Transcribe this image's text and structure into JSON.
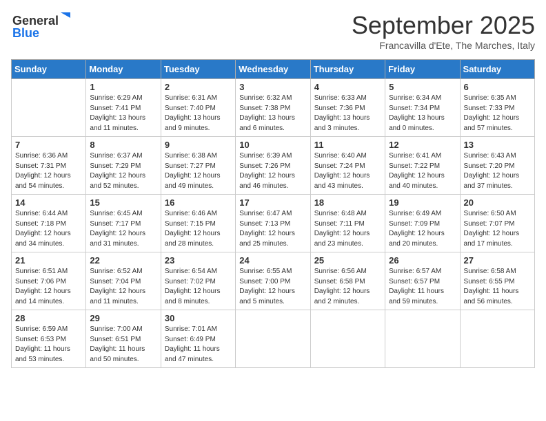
{
  "header": {
    "logo_line1": "General",
    "logo_line2": "Blue",
    "month": "September 2025",
    "location": "Francavilla d'Ete, The Marches, Italy"
  },
  "weekdays": [
    "Sunday",
    "Monday",
    "Tuesday",
    "Wednesday",
    "Thursday",
    "Friday",
    "Saturday"
  ],
  "weeks": [
    [
      {
        "day": "",
        "sunrise": "",
        "sunset": "",
        "daylight": ""
      },
      {
        "day": "1",
        "sunrise": "Sunrise: 6:29 AM",
        "sunset": "Sunset: 7:41 PM",
        "daylight": "Daylight: 13 hours and 11 minutes."
      },
      {
        "day": "2",
        "sunrise": "Sunrise: 6:31 AM",
        "sunset": "Sunset: 7:40 PM",
        "daylight": "Daylight: 13 hours and 9 minutes."
      },
      {
        "day": "3",
        "sunrise": "Sunrise: 6:32 AM",
        "sunset": "Sunset: 7:38 PM",
        "daylight": "Daylight: 13 hours and 6 minutes."
      },
      {
        "day": "4",
        "sunrise": "Sunrise: 6:33 AM",
        "sunset": "Sunset: 7:36 PM",
        "daylight": "Daylight: 13 hours and 3 minutes."
      },
      {
        "day": "5",
        "sunrise": "Sunrise: 6:34 AM",
        "sunset": "Sunset: 7:34 PM",
        "daylight": "Daylight: 13 hours and 0 minutes."
      },
      {
        "day": "6",
        "sunrise": "Sunrise: 6:35 AM",
        "sunset": "Sunset: 7:33 PM",
        "daylight": "Daylight: 12 hours and 57 minutes."
      }
    ],
    [
      {
        "day": "7",
        "sunrise": "Sunrise: 6:36 AM",
        "sunset": "Sunset: 7:31 PM",
        "daylight": "Daylight: 12 hours and 54 minutes."
      },
      {
        "day": "8",
        "sunrise": "Sunrise: 6:37 AM",
        "sunset": "Sunset: 7:29 PM",
        "daylight": "Daylight: 12 hours and 52 minutes."
      },
      {
        "day": "9",
        "sunrise": "Sunrise: 6:38 AM",
        "sunset": "Sunset: 7:27 PM",
        "daylight": "Daylight: 12 hours and 49 minutes."
      },
      {
        "day": "10",
        "sunrise": "Sunrise: 6:39 AM",
        "sunset": "Sunset: 7:26 PM",
        "daylight": "Daylight: 12 hours and 46 minutes."
      },
      {
        "day": "11",
        "sunrise": "Sunrise: 6:40 AM",
        "sunset": "Sunset: 7:24 PM",
        "daylight": "Daylight: 12 hours and 43 minutes."
      },
      {
        "day": "12",
        "sunrise": "Sunrise: 6:41 AM",
        "sunset": "Sunset: 7:22 PM",
        "daylight": "Daylight: 12 hours and 40 minutes."
      },
      {
        "day": "13",
        "sunrise": "Sunrise: 6:43 AM",
        "sunset": "Sunset: 7:20 PM",
        "daylight": "Daylight: 12 hours and 37 minutes."
      }
    ],
    [
      {
        "day": "14",
        "sunrise": "Sunrise: 6:44 AM",
        "sunset": "Sunset: 7:18 PM",
        "daylight": "Daylight: 12 hours and 34 minutes."
      },
      {
        "day": "15",
        "sunrise": "Sunrise: 6:45 AM",
        "sunset": "Sunset: 7:17 PM",
        "daylight": "Daylight: 12 hours and 31 minutes."
      },
      {
        "day": "16",
        "sunrise": "Sunrise: 6:46 AM",
        "sunset": "Sunset: 7:15 PM",
        "daylight": "Daylight: 12 hours and 28 minutes."
      },
      {
        "day": "17",
        "sunrise": "Sunrise: 6:47 AM",
        "sunset": "Sunset: 7:13 PM",
        "daylight": "Daylight: 12 hours and 25 minutes."
      },
      {
        "day": "18",
        "sunrise": "Sunrise: 6:48 AM",
        "sunset": "Sunset: 7:11 PM",
        "daylight": "Daylight: 12 hours and 23 minutes."
      },
      {
        "day": "19",
        "sunrise": "Sunrise: 6:49 AM",
        "sunset": "Sunset: 7:09 PM",
        "daylight": "Daylight: 12 hours and 20 minutes."
      },
      {
        "day": "20",
        "sunrise": "Sunrise: 6:50 AM",
        "sunset": "Sunset: 7:07 PM",
        "daylight": "Daylight: 12 hours and 17 minutes."
      }
    ],
    [
      {
        "day": "21",
        "sunrise": "Sunrise: 6:51 AM",
        "sunset": "Sunset: 7:06 PM",
        "daylight": "Daylight: 12 hours and 14 minutes."
      },
      {
        "day": "22",
        "sunrise": "Sunrise: 6:52 AM",
        "sunset": "Sunset: 7:04 PM",
        "daylight": "Daylight: 12 hours and 11 minutes."
      },
      {
        "day": "23",
        "sunrise": "Sunrise: 6:54 AM",
        "sunset": "Sunset: 7:02 PM",
        "daylight": "Daylight: 12 hours and 8 minutes."
      },
      {
        "day": "24",
        "sunrise": "Sunrise: 6:55 AM",
        "sunset": "Sunset: 7:00 PM",
        "daylight": "Daylight: 12 hours and 5 minutes."
      },
      {
        "day": "25",
        "sunrise": "Sunrise: 6:56 AM",
        "sunset": "Sunset: 6:58 PM",
        "daylight": "Daylight: 12 hours and 2 minutes."
      },
      {
        "day": "26",
        "sunrise": "Sunrise: 6:57 AM",
        "sunset": "Sunset: 6:57 PM",
        "daylight": "Daylight: 11 hours and 59 minutes."
      },
      {
        "day": "27",
        "sunrise": "Sunrise: 6:58 AM",
        "sunset": "Sunset: 6:55 PM",
        "daylight": "Daylight: 11 hours and 56 minutes."
      }
    ],
    [
      {
        "day": "28",
        "sunrise": "Sunrise: 6:59 AM",
        "sunset": "Sunset: 6:53 PM",
        "daylight": "Daylight: 11 hours and 53 minutes."
      },
      {
        "day": "29",
        "sunrise": "Sunrise: 7:00 AM",
        "sunset": "Sunset: 6:51 PM",
        "daylight": "Daylight: 11 hours and 50 minutes."
      },
      {
        "day": "30",
        "sunrise": "Sunrise: 7:01 AM",
        "sunset": "Sunset: 6:49 PM",
        "daylight": "Daylight: 11 hours and 47 minutes."
      },
      {
        "day": "",
        "sunrise": "",
        "sunset": "",
        "daylight": ""
      },
      {
        "day": "",
        "sunrise": "",
        "sunset": "",
        "daylight": ""
      },
      {
        "day": "",
        "sunrise": "",
        "sunset": "",
        "daylight": ""
      },
      {
        "day": "",
        "sunrise": "",
        "sunset": "",
        "daylight": ""
      }
    ]
  ]
}
